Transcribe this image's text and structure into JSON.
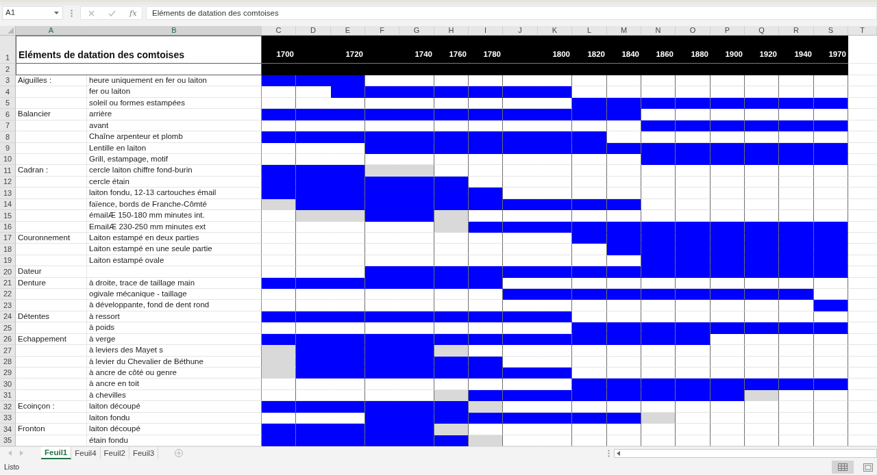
{
  "name_box": {
    "value": "A1"
  },
  "formula_bar": {
    "function_label": "fx",
    "value": "Eléments de datation des comtoises"
  },
  "columns": [
    {
      "letter": "A",
      "kind": "category",
      "selected": true
    },
    {
      "letter": "B",
      "kind": "item",
      "selected": true
    },
    {
      "letter": "C",
      "kind": "period",
      "selected": false,
      "year": "1700"
    },
    {
      "letter": "D",
      "kind": "period",
      "selected": false
    },
    {
      "letter": "E",
      "kind": "period",
      "selected": false,
      "year": "1720"
    },
    {
      "letter": "F",
      "kind": "period",
      "selected": false
    },
    {
      "letter": "G",
      "kind": "period",
      "selected": false,
      "year": "1740"
    },
    {
      "letter": "H",
      "kind": "period",
      "selected": false,
      "year": "1760"
    },
    {
      "letter": "I",
      "kind": "period",
      "selected": false,
      "year": "1780"
    },
    {
      "letter": "J",
      "kind": "period",
      "selected": false
    },
    {
      "letter": "K",
      "kind": "period",
      "selected": false,
      "year": "1800"
    },
    {
      "letter": "L",
      "kind": "period",
      "selected": false,
      "year": "1820"
    },
    {
      "letter": "M",
      "kind": "period",
      "selected": false,
      "year": "1840"
    },
    {
      "letter": "N",
      "kind": "period",
      "selected": false,
      "year": "1860"
    },
    {
      "letter": "O",
      "kind": "period",
      "selected": false,
      "year": "1880"
    },
    {
      "letter": "P",
      "kind": "period",
      "selected": false,
      "year": "1900"
    },
    {
      "letter": "Q",
      "kind": "period",
      "selected": false,
      "year": "1920"
    },
    {
      "letter": "R",
      "kind": "period",
      "selected": false,
      "year": "1940"
    },
    {
      "letter": "S",
      "kind": "period",
      "selected": false,
      "year": "1970"
    },
    {
      "letter": "T",
      "kind": "spare",
      "selected": false
    }
  ],
  "title_row": {
    "number": "1",
    "title": "Eléments de datation des comtoises"
  },
  "band_row": {
    "number": "2"
  },
  "rows": [
    {
      "number": "3",
      "category": "Aiguilles :",
      "item": "heure uniquement en fer ou laiton",
      "cells": [
        {
          "color": "#0000ff"
        },
        {
          "color": "#0000ff"
        },
        {
          "color": "#0000ff"
        },
        {
          "color": "#ffffff"
        },
        {
          "color": "#ffffff"
        },
        {
          "color": "#ffffff"
        },
        {
          "color": "#ffffff"
        },
        {
          "color": "#ffffff"
        },
        {
          "color": "#ffffff"
        },
        {
          "color": "#ffffff"
        },
        {
          "color": "#ffffff"
        },
        {
          "color": "#ffffff"
        },
        {
          "color": "#ffffff"
        },
        {
          "color": "#ffffff"
        },
        {
          "color": "#ffffff"
        },
        {
          "color": "#ffffff"
        },
        {
          "color": "#ffffff"
        }
      ]
    },
    {
      "number": "4",
      "item": "fer ou laiton",
      "cells": [
        {
          "color": "#ffffff"
        },
        {
          "color": "#ffffff"
        },
        {
          "color": "#0000ff"
        },
        {
          "color": "#0000ff"
        },
        {
          "color": "#0000ff"
        },
        {
          "color": "#0000ff"
        },
        {
          "color": "#0000ff"
        },
        {
          "color": "#0000ff"
        },
        {
          "color": "#0000ff"
        },
        {
          "color": "#ffffff"
        },
        {
          "color": "#ffffff"
        },
        {
          "color": "#ffffff"
        },
        {
          "color": "#ffffff"
        },
        {
          "color": "#ffffff"
        },
        {
          "color": "#ffffff"
        },
        {
          "color": "#ffffff"
        },
        {
          "color": "#ffffff"
        }
      ]
    },
    {
      "number": "5",
      "item": "soleil ou formes estampées",
      "cells": [
        {
          "color": "#ffffff"
        },
        {
          "color": "#ffffff"
        },
        {
          "color": "#ffffff"
        },
        {
          "color": "#ffffff"
        },
        {
          "color": "#ffffff"
        },
        {
          "color": "#ffffff"
        },
        {
          "color": "#ffffff"
        },
        {
          "color": "#ffffff"
        },
        {
          "color": "#ffffff"
        },
        {
          "color": "#0000ff"
        },
        {
          "color": "#0000ff"
        },
        {
          "color": "#0000ff"
        },
        {
          "color": "#0000ff"
        },
        {
          "color": "#0000ff"
        },
        {
          "color": "#0000ff"
        },
        {
          "color": "#0000ff"
        },
        {
          "color": "#0000ff"
        }
      ]
    },
    {
      "number": "6",
      "category": "Balancier",
      "item": "arrière",
      "cells": [
        {
          "color": "#0000ff"
        },
        {
          "color": "#0000ff"
        },
        {
          "color": "#0000ff"
        },
        {
          "color": "#0000ff"
        },
        {
          "color": "#0000ff"
        },
        {
          "color": "#0000ff"
        },
        {
          "color": "#0000ff"
        },
        {
          "color": "#0000ff"
        },
        {
          "color": "#0000ff"
        },
        {
          "color": "#0000ff"
        },
        {
          "color": "#0000ff"
        },
        {
          "color": "#ffffff"
        },
        {
          "color": "#ffffff"
        },
        {
          "color": "#ffffff"
        },
        {
          "color": "#ffffff"
        },
        {
          "color": "#ffffff"
        },
        {
          "color": "#ffffff"
        }
      ]
    },
    {
      "number": "7",
      "item": "avant",
      "cells": [
        {
          "color": "#ffffff"
        },
        {
          "color": "#ffffff"
        },
        {
          "color": "#ffffff"
        },
        {
          "color": "#ffffff"
        },
        {
          "color": "#ffffff"
        },
        {
          "color": "#ffffff"
        },
        {
          "color": "#ffffff"
        },
        {
          "color": "#ffffff"
        },
        {
          "color": "#ffffff"
        },
        {
          "color": "#ffffff"
        },
        {
          "color": "#ffffff"
        },
        {
          "color": "#0000ff"
        },
        {
          "color": "#0000ff"
        },
        {
          "color": "#0000ff"
        },
        {
          "color": "#0000ff"
        },
        {
          "color": "#0000ff"
        },
        {
          "color": "#0000ff"
        }
      ]
    },
    {
      "number": "8",
      "item": "Chaîne arpenteur et plomb",
      "cells": [
        {
          "color": "#0000ff"
        },
        {
          "color": "#0000ff"
        },
        {
          "color": "#0000ff"
        },
        {
          "color": "#0000ff"
        },
        {
          "color": "#0000ff"
        },
        {
          "color": "#0000ff"
        },
        {
          "color": "#0000ff"
        },
        {
          "color": "#0000ff"
        },
        {
          "color": "#0000ff"
        },
        {
          "color": "#0000ff"
        },
        {
          "color": "#ffffff"
        },
        {
          "color": "#ffffff"
        },
        {
          "color": "#ffffff"
        },
        {
          "color": "#ffffff"
        },
        {
          "color": "#ffffff"
        },
        {
          "color": "#ffffff"
        },
        {
          "color": "#ffffff"
        }
      ]
    },
    {
      "number": "9",
      "item": "Lentille en laiton",
      "cells": [
        {
          "color": "#ffffff"
        },
        {
          "color": "#ffffff"
        },
        {
          "color": "#ffffff"
        },
        {
          "color": "#0000ff"
        },
        {
          "color": "#0000ff"
        },
        {
          "color": "#0000ff"
        },
        {
          "color": "#0000ff"
        },
        {
          "color": "#0000ff"
        },
        {
          "color": "#0000ff"
        },
        {
          "color": "#0000ff"
        },
        {
          "color": "#0000ff"
        },
        {
          "color": "#0000ff"
        },
        {
          "color": "#0000ff"
        },
        {
          "color": "#0000ff"
        },
        {
          "color": "#0000ff"
        },
        {
          "color": "#0000ff"
        },
        {
          "color": "#0000ff"
        }
      ]
    },
    {
      "number": "10",
      "item": "Grill, estampage, motif",
      "cells": [
        {
          "color": "#ffffff"
        },
        {
          "color": "#ffffff"
        },
        {
          "color": "#ffffff"
        },
        {
          "color": "#ffffff"
        },
        {
          "color": "#ffffff"
        },
        {
          "color": "#ffffff"
        },
        {
          "color": "#ffffff"
        },
        {
          "color": "#ffffff"
        },
        {
          "color": "#ffffff"
        },
        {
          "color": "#ffffff"
        },
        {
          "color": "#ffffff"
        },
        {
          "color": "#0000ff"
        },
        {
          "color": "#0000ff"
        },
        {
          "color": "#0000ff"
        },
        {
          "color": "#0000ff"
        },
        {
          "color": "#0000ff"
        },
        {
          "color": "#0000ff"
        }
      ]
    },
    {
      "number": "11",
      "category": "Cadran :",
      "item": "cercle laiton chiffre fond-burin",
      "cells": [
        {
          "color": "#0000ff"
        },
        {
          "color": "#0000ff"
        },
        {
          "color": "#0000ff"
        },
        {
          "color": "#d9d9d9"
        },
        {
          "color": "#d9d9d9"
        },
        {
          "color": "#ffffff"
        },
        {
          "color": "#ffffff"
        },
        {
          "color": "#ffffff"
        },
        {
          "color": "#ffffff"
        },
        {
          "color": "#ffffff"
        },
        {
          "color": "#ffffff"
        },
        {
          "color": "#ffffff"
        },
        {
          "color": "#ffffff"
        },
        {
          "color": "#ffffff"
        },
        {
          "color": "#ffffff"
        },
        {
          "color": "#ffffff"
        },
        {
          "color": "#ffffff"
        }
      ]
    },
    {
      "number": "12",
      "item": "cercle étain",
      "cells": [
        {
          "color": "#0000ff"
        },
        {
          "color": "#0000ff"
        },
        {
          "color": "#0000ff"
        },
        {
          "color": "#0000ff"
        },
        {
          "color": "#0000ff"
        },
        {
          "color": "#0000ff"
        },
        {
          "color": "#ffffff"
        },
        {
          "color": "#ffffff"
        },
        {
          "color": "#ffffff"
        },
        {
          "color": "#ffffff"
        },
        {
          "color": "#ffffff"
        },
        {
          "color": "#ffffff"
        },
        {
          "color": "#ffffff"
        },
        {
          "color": "#ffffff"
        },
        {
          "color": "#ffffff"
        },
        {
          "color": "#ffffff"
        },
        {
          "color": "#ffffff"
        }
      ]
    },
    {
      "number": "13",
      "item": "laiton fondu, 12-13 cartouches émail",
      "cells": [
        {
          "color": "#0000ff"
        },
        {
          "color": "#0000ff"
        },
        {
          "color": "#0000ff"
        },
        {
          "color": "#0000ff"
        },
        {
          "color": "#0000ff"
        },
        {
          "color": "#0000ff"
        },
        {
          "color": "#0000ff"
        },
        {
          "color": "#ffffff"
        },
        {
          "color": "#ffffff"
        },
        {
          "color": "#ffffff"
        },
        {
          "color": "#ffffff"
        },
        {
          "color": "#ffffff"
        },
        {
          "color": "#ffffff"
        },
        {
          "color": "#ffffff"
        },
        {
          "color": "#ffffff"
        },
        {
          "color": "#ffffff"
        },
        {
          "color": "#ffffff"
        }
      ]
    },
    {
      "number": "14",
      "item": "faïence, bords de Franche-Cômté",
      "cells": [
        {
          "color": "#d9d9d9"
        },
        {
          "color": "#0000ff"
        },
        {
          "color": "#0000ff"
        },
        {
          "color": "#0000ff"
        },
        {
          "color": "#0000ff"
        },
        {
          "color": "#0000ff"
        },
        {
          "color": "#0000ff"
        },
        {
          "color": "#0000ff"
        },
        {
          "color": "#0000ff"
        },
        {
          "color": "#0000ff"
        },
        {
          "color": "#0000ff"
        },
        {
          "color": "#ffffff"
        },
        {
          "color": "#ffffff"
        },
        {
          "color": "#ffffff"
        },
        {
          "color": "#ffffff"
        },
        {
          "color": "#ffffff"
        },
        {
          "color": "#ffffff"
        }
      ]
    },
    {
      "number": "15",
      "item": "émailÆ 150-180 mm minutes int.",
      "cells": [
        {
          "color": "#ffffff"
        },
        {
          "color": "#d9d9d9"
        },
        {
          "color": "#d9d9d9"
        },
        {
          "color": "#0000ff"
        },
        {
          "color": "#0000ff"
        },
        {
          "color": "#d9d9d9"
        },
        {
          "color": "#ffffff"
        },
        {
          "color": "#ffffff"
        },
        {
          "color": "#ffffff"
        },
        {
          "color": "#ffffff"
        },
        {
          "color": "#ffffff"
        },
        {
          "color": "#ffffff"
        },
        {
          "color": "#ffffff"
        },
        {
          "color": "#ffffff"
        },
        {
          "color": "#ffffff"
        },
        {
          "color": "#ffffff"
        },
        {
          "color": "#ffffff"
        }
      ]
    },
    {
      "number": "16",
      "item": "EmailÆ 230-250 mm minutes ext",
      "cells": [
        {
          "color": "#ffffff"
        },
        {
          "color": "#ffffff"
        },
        {
          "color": "#ffffff"
        },
        {
          "color": "#ffffff"
        },
        {
          "color": "#ffffff"
        },
        {
          "color": "#d9d9d9"
        },
        {
          "color": "#0000ff"
        },
        {
          "color": "#0000ff"
        },
        {
          "color": "#0000ff"
        },
        {
          "color": "#0000ff"
        },
        {
          "color": "#0000ff"
        },
        {
          "color": "#0000ff"
        },
        {
          "color": "#0000ff"
        },
        {
          "color": "#0000ff"
        },
        {
          "color": "#0000ff"
        },
        {
          "color": "#0000ff"
        },
        {
          "color": "#0000ff"
        }
      ]
    },
    {
      "number": "17",
      "category": "Couronnement",
      "item": "Laiton estampé en deux parties",
      "cells": [
        {
          "color": "#ffffff"
        },
        {
          "color": "#ffffff"
        },
        {
          "color": "#ffffff"
        },
        {
          "color": "#ffffff"
        },
        {
          "color": "#ffffff"
        },
        {
          "color": "#ffffff"
        },
        {
          "color": "#ffffff"
        },
        {
          "color": "#ffffff"
        },
        {
          "color": "#ffffff"
        },
        {
          "color": "#0000ff"
        },
        {
          "color": "#0000ff"
        },
        {
          "color": "#0000ff"
        },
        {
          "color": "#0000ff"
        },
        {
          "color": "#0000ff"
        },
        {
          "color": "#0000ff"
        },
        {
          "color": "#0000ff"
        },
        {
          "color": "#0000ff"
        }
      ]
    },
    {
      "number": "18",
      "item": "Laiton estampé en une seule partie",
      "cells": [
        {
          "color": "#ffffff"
        },
        {
          "color": "#ffffff"
        },
        {
          "color": "#ffffff"
        },
        {
          "color": "#ffffff"
        },
        {
          "color": "#ffffff"
        },
        {
          "color": "#ffffff"
        },
        {
          "color": "#ffffff"
        },
        {
          "color": "#ffffff"
        },
        {
          "color": "#ffffff"
        },
        {
          "color": "#ffffff"
        },
        {
          "color": "#0000ff"
        },
        {
          "color": "#0000ff"
        },
        {
          "color": "#0000ff"
        },
        {
          "color": "#0000ff"
        },
        {
          "color": "#0000ff"
        },
        {
          "color": "#0000ff"
        },
        {
          "color": "#0000ff"
        }
      ]
    },
    {
      "number": "19",
      "item": "Laiton estampé ovale",
      "cells": [
        {
          "color": "#ffffff"
        },
        {
          "color": "#ffffff"
        },
        {
          "color": "#ffffff"
        },
        {
          "color": "#ffffff"
        },
        {
          "color": "#ffffff"
        },
        {
          "color": "#ffffff"
        },
        {
          "color": "#ffffff"
        },
        {
          "color": "#ffffff"
        },
        {
          "color": "#ffffff"
        },
        {
          "color": "#ffffff"
        },
        {
          "color": "#ffffff"
        },
        {
          "color": "#0000ff"
        },
        {
          "color": "#0000ff"
        },
        {
          "color": "#0000ff"
        },
        {
          "color": "#0000ff"
        },
        {
          "color": "#0000ff"
        },
        {
          "color": "#0000ff"
        }
      ]
    },
    {
      "number": "20",
      "category": "Dateur",
      "cells": [
        {
          "color": "#ffffff"
        },
        {
          "color": "#ffffff"
        },
        {
          "color": "#ffffff"
        },
        {
          "color": "#0000ff"
        },
        {
          "color": "#0000ff"
        },
        {
          "color": "#0000ff"
        },
        {
          "color": "#0000ff"
        },
        {
          "color": "#0000ff"
        },
        {
          "color": "#0000ff"
        },
        {
          "color": "#0000ff"
        },
        {
          "color": "#0000ff"
        },
        {
          "color": "#0000ff"
        },
        {
          "color": "#0000ff"
        },
        {
          "color": "#0000ff"
        },
        {
          "color": "#0000ff"
        },
        {
          "color": "#0000ff"
        },
        {
          "color": "#0000ff"
        }
      ]
    },
    {
      "number": "21",
      "category": "Denture",
      "item": "à droite, trace de taillage main",
      "cells": [
        {
          "color": "#0000ff"
        },
        {
          "color": "#0000ff"
        },
        {
          "color": "#0000ff"
        },
        {
          "color": "#0000ff"
        },
        {
          "color": "#0000ff"
        },
        {
          "color": "#0000ff"
        },
        {
          "color": "#0000ff"
        },
        {
          "color": "#ffffff"
        },
        {
          "color": "#ffffff"
        },
        {
          "color": "#ffffff"
        },
        {
          "color": "#ffffff"
        },
        {
          "color": "#ffffff"
        },
        {
          "color": "#ffffff"
        },
        {
          "color": "#ffffff"
        },
        {
          "color": "#ffffff"
        },
        {
          "color": "#ffffff"
        },
        {
          "color": "#ffffff"
        }
      ]
    },
    {
      "number": "22",
      "item": "ogivale mécanique - taillage",
      "cells": [
        {
          "color": "#ffffff"
        },
        {
          "color": "#ffffff"
        },
        {
          "color": "#ffffff"
        },
        {
          "color": "#ffffff"
        },
        {
          "color": "#ffffff"
        },
        {
          "color": "#ffffff"
        },
        {
          "color": "#ffffff"
        },
        {
          "color": "#0000ff"
        },
        {
          "color": "#0000ff"
        },
        {
          "color": "#0000ff"
        },
        {
          "color": "#0000ff"
        },
        {
          "color": "#0000ff"
        },
        {
          "color": "#0000ff"
        },
        {
          "color": "#0000ff"
        },
        {
          "color": "#0000ff"
        },
        {
          "color": "#0000ff"
        },
        {
          "color": "#ffffff"
        }
      ]
    },
    {
      "number": "23",
      "item": "à développante, fond de dent rond",
      "cells": [
        {
          "color": "#ffffff"
        },
        {
          "color": "#ffffff"
        },
        {
          "color": "#ffffff"
        },
        {
          "color": "#ffffff"
        },
        {
          "color": "#ffffff"
        },
        {
          "color": "#ffffff"
        },
        {
          "color": "#ffffff"
        },
        {
          "color": "#ffffff"
        },
        {
          "color": "#ffffff"
        },
        {
          "color": "#ffffff"
        },
        {
          "color": "#ffffff"
        },
        {
          "color": "#ffffff"
        },
        {
          "color": "#ffffff"
        },
        {
          "color": "#ffffff"
        },
        {
          "color": "#ffffff"
        },
        {
          "color": "#ffffff"
        },
        {
          "color": "#0000ff"
        }
      ]
    },
    {
      "number": "24",
      "category": "Détentes",
      "item": "à ressort",
      "cells": [
        {
          "color": "#0000ff"
        },
        {
          "color": "#0000ff"
        },
        {
          "color": "#0000ff"
        },
        {
          "color": "#0000ff"
        },
        {
          "color": "#0000ff"
        },
        {
          "color": "#0000ff"
        },
        {
          "color": "#0000ff"
        },
        {
          "color": "#0000ff"
        },
        {
          "color": "#0000ff"
        },
        {
          "color": "#ffffff"
        },
        {
          "color": "#ffffff"
        },
        {
          "color": "#ffffff"
        },
        {
          "color": "#ffffff"
        },
        {
          "color": "#ffffff"
        },
        {
          "color": "#ffffff"
        },
        {
          "color": "#ffffff"
        },
        {
          "color": "#ffffff"
        }
      ]
    },
    {
      "number": "25",
      "item": "à poids",
      "cells": [
        {
          "color": "#ffffff"
        },
        {
          "color": "#ffffff"
        },
        {
          "color": "#ffffff"
        },
        {
          "color": "#ffffff"
        },
        {
          "color": "#ffffff"
        },
        {
          "color": "#ffffff"
        },
        {
          "color": "#ffffff"
        },
        {
          "color": "#ffffff"
        },
        {
          "color": "#ffffff"
        },
        {
          "color": "#0000ff"
        },
        {
          "color": "#0000ff"
        },
        {
          "color": "#0000ff"
        },
        {
          "color": "#0000ff"
        },
        {
          "color": "#0000ff"
        },
        {
          "color": "#0000ff"
        },
        {
          "color": "#0000ff"
        },
        {
          "color": "#0000ff"
        }
      ]
    },
    {
      "number": "26",
      "category": "Echappement",
      "item": "à verge",
      "cells": [
        {
          "color": "#0000ff"
        },
        {
          "color": "#0000ff"
        },
        {
          "color": "#0000ff"
        },
        {
          "color": "#0000ff"
        },
        {
          "color": "#0000ff"
        },
        {
          "color": "#0000ff"
        },
        {
          "color": "#0000ff"
        },
        {
          "color": "#0000ff"
        },
        {
          "color": "#0000ff"
        },
        {
          "color": "#0000ff"
        },
        {
          "color": "#0000ff"
        },
        {
          "color": "#0000ff"
        },
        {
          "color": "#0000ff"
        },
        {
          "color": "#ffffff"
        },
        {
          "color": "#ffffff"
        },
        {
          "color": "#ffffff"
        },
        {
          "color": "#ffffff"
        }
      ]
    },
    {
      "number": "27",
      "item": "à leviers des Mayet s",
      "cells": [
        {
          "color": "#d9d9d9"
        },
        {
          "color": "#0000ff"
        },
        {
          "color": "#0000ff"
        },
        {
          "color": "#0000ff"
        },
        {
          "color": "#0000ff"
        },
        {
          "color": "#d9d9d9"
        },
        {
          "color": "#ffffff"
        },
        {
          "color": "#ffffff"
        },
        {
          "color": "#ffffff"
        },
        {
          "color": "#ffffff"
        },
        {
          "color": "#ffffff"
        },
        {
          "color": "#ffffff"
        },
        {
          "color": "#ffffff"
        },
        {
          "color": "#ffffff"
        },
        {
          "color": "#ffffff"
        },
        {
          "color": "#ffffff"
        },
        {
          "color": "#ffffff"
        }
      ]
    },
    {
      "number": "28",
      "item": "à levier du Chevalier de Béthune",
      "cells": [
        {
          "color": "#d9d9d9"
        },
        {
          "color": "#0000ff"
        },
        {
          "color": "#0000ff"
        },
        {
          "color": "#0000ff"
        },
        {
          "color": "#0000ff"
        },
        {
          "color": "#0000ff"
        },
        {
          "color": "#0000ff"
        },
        {
          "color": "#ffffff"
        },
        {
          "color": "#ffffff"
        },
        {
          "color": "#ffffff"
        },
        {
          "color": "#ffffff"
        },
        {
          "color": "#ffffff"
        },
        {
          "color": "#ffffff"
        },
        {
          "color": "#ffffff"
        },
        {
          "color": "#ffffff"
        },
        {
          "color": "#ffffff"
        },
        {
          "color": "#ffffff"
        }
      ]
    },
    {
      "number": "29",
      "item": "à ancre de côté ou genre",
      "cells": [
        {
          "color": "#d9d9d9"
        },
        {
          "color": "#0000ff"
        },
        {
          "color": "#0000ff"
        },
        {
          "color": "#0000ff"
        },
        {
          "color": "#0000ff"
        },
        {
          "color": "#0000ff"
        },
        {
          "color": "#0000ff"
        },
        {
          "color": "#0000ff"
        },
        {
          "color": "#0000ff"
        },
        {
          "color": "#ffffff"
        },
        {
          "color": "#ffffff"
        },
        {
          "color": "#ffffff"
        },
        {
          "color": "#ffffff"
        },
        {
          "color": "#ffffff"
        },
        {
          "color": "#ffffff"
        },
        {
          "color": "#ffffff"
        },
        {
          "color": "#ffffff"
        }
      ]
    },
    {
      "number": "30",
      "item": "à ancre en toit",
      "cells": [
        {
          "color": "#ffffff"
        },
        {
          "color": "#ffffff"
        },
        {
          "color": "#ffffff"
        },
        {
          "color": "#ffffff"
        },
        {
          "color": "#ffffff"
        },
        {
          "color": "#ffffff"
        },
        {
          "color": "#ffffff"
        },
        {
          "color": "#ffffff"
        },
        {
          "color": "#ffffff"
        },
        {
          "color": "#0000ff"
        },
        {
          "color": "#0000ff"
        },
        {
          "color": "#0000ff"
        },
        {
          "color": "#0000ff"
        },
        {
          "color": "#0000ff"
        },
        {
          "color": "#0000ff"
        },
        {
          "color": "#0000ff"
        },
        {
          "color": "#0000ff"
        }
      ]
    },
    {
      "number": "31",
      "item": "à chevilles",
      "cells": [
        {
          "color": "#ffffff"
        },
        {
          "color": "#ffffff"
        },
        {
          "color": "#ffffff"
        },
        {
          "color": "#ffffff"
        },
        {
          "color": "#ffffff"
        },
        {
          "color": "#d9d9d9"
        },
        {
          "color": "#0000ff"
        },
        {
          "color": "#0000ff"
        },
        {
          "color": "#0000ff"
        },
        {
          "color": "#0000ff"
        },
        {
          "color": "#0000ff"
        },
        {
          "color": "#0000ff"
        },
        {
          "color": "#0000ff"
        },
        {
          "color": "#0000ff"
        },
        {
          "color": "#d9d9d9"
        },
        {
          "color": "#ffffff"
        },
        {
          "color": "#ffffff"
        }
      ]
    },
    {
      "number": "32",
      "category": "Ecoinçon :",
      "item": "laiton découpé",
      "cells": [
        {
          "color": "#0000ff"
        },
        {
          "color": "#0000ff"
        },
        {
          "color": "#0000ff"
        },
        {
          "color": "#0000ff"
        },
        {
          "color": "#0000ff"
        },
        {
          "color": "#0000ff"
        },
        {
          "color": "#d9d9d9"
        },
        {
          "color": "#ffffff"
        },
        {
          "color": "#ffffff"
        },
        {
          "color": "#ffffff"
        },
        {
          "color": "#ffffff"
        },
        {
          "color": "#ffffff"
        },
        {
          "color": "#ffffff"
        },
        {
          "color": "#ffffff"
        },
        {
          "color": "#ffffff"
        },
        {
          "color": "#ffffff"
        },
        {
          "color": "#ffffff"
        }
      ]
    },
    {
      "number": "33",
      "item": "laiton fondu",
      "cells": [
        {
          "color": "#ffffff"
        },
        {
          "color": "#ffffff"
        },
        {
          "color": "#ffffff"
        },
        {
          "color": "#0000ff"
        },
        {
          "color": "#0000ff"
        },
        {
          "color": "#0000ff"
        },
        {
          "color": "#0000ff"
        },
        {
          "color": "#0000ff"
        },
        {
          "color": "#0000ff"
        },
        {
          "color": "#0000ff"
        },
        {
          "color": "#0000ff"
        },
        {
          "color": "#d9d9d9"
        },
        {
          "color": "#ffffff"
        },
        {
          "color": "#ffffff"
        },
        {
          "color": "#ffffff"
        },
        {
          "color": "#ffffff"
        },
        {
          "color": "#ffffff"
        }
      ]
    },
    {
      "number": "34",
      "category": "Fronton",
      "item": "laiton découpé",
      "cells": [
        {
          "color": "#0000ff"
        },
        {
          "color": "#0000ff"
        },
        {
          "color": "#0000ff"
        },
        {
          "color": "#0000ff"
        },
        {
          "color": "#0000ff"
        },
        {
          "color": "#d9d9d9"
        },
        {
          "color": "#ffffff"
        },
        {
          "color": "#ffffff"
        },
        {
          "color": "#ffffff"
        },
        {
          "color": "#ffffff"
        },
        {
          "color": "#ffffff"
        },
        {
          "color": "#ffffff"
        },
        {
          "color": "#ffffff"
        },
        {
          "color": "#ffffff"
        },
        {
          "color": "#ffffff"
        },
        {
          "color": "#ffffff"
        },
        {
          "color": "#ffffff"
        }
      ]
    },
    {
      "number": "35",
      "item": "étain fondu",
      "cells": [
        {
          "color": "#0000ff"
        },
        {
          "color": "#0000ff"
        },
        {
          "color": "#0000ff"
        },
        {
          "color": "#0000ff"
        },
        {
          "color": "#0000ff"
        },
        {
          "color": "#0000ff"
        },
        {
          "color": "#d9d9d9"
        },
        {
          "color": "#ffffff"
        },
        {
          "color": "#ffffff"
        },
        {
          "color": "#ffffff"
        },
        {
          "color": "#ffffff"
        },
        {
          "color": "#ffffff"
        },
        {
          "color": "#ffffff"
        },
        {
          "color": "#ffffff"
        },
        {
          "color": "#ffffff"
        },
        {
          "color": "#ffffff"
        },
        {
          "color": "#ffffff"
        }
      ]
    }
  ],
  "sheet_tabs": [
    {
      "label": "Feuil1",
      "selected": true
    },
    {
      "label": "Feuil4",
      "selected": false
    },
    {
      "label": "Feuil2",
      "selected": false
    },
    {
      "label": "Feuil3",
      "selected": false
    }
  ],
  "status_bar": {
    "text": "Listo"
  }
}
